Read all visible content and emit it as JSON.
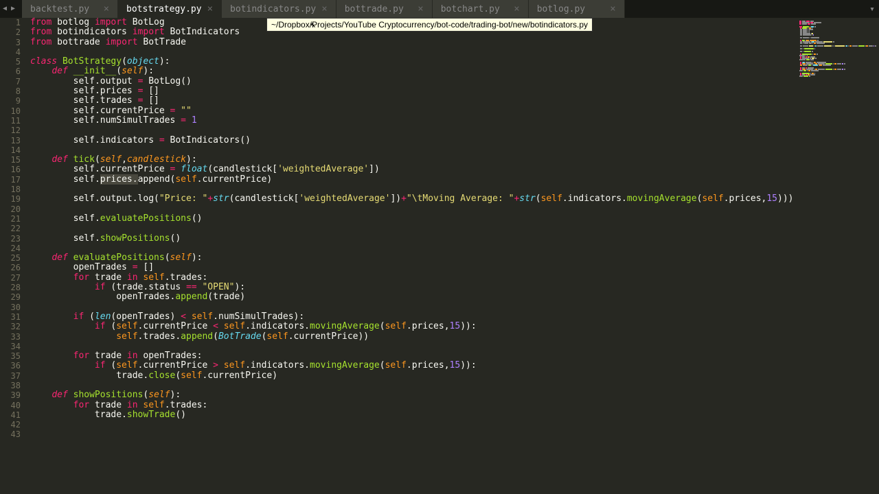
{
  "tabs": [
    {
      "label": "backtest.py",
      "active": false
    },
    {
      "label": "botstrategy.py",
      "active": true
    },
    {
      "label": "botindicators.py",
      "active": false
    },
    {
      "label": "bottrade.py",
      "active": false
    },
    {
      "label": "botchart.py",
      "active": false
    },
    {
      "label": "botlog.py",
      "active": false
    }
  ],
  "tooltip": "~/Dropbox/Projects/YouTube Cryptocurrency/bot-code/trading-bot/new/botindicators.py",
  "line_count": 43,
  "code_tokens": [
    [
      {
        "t": "from ",
        "c": "c-keyword"
      },
      {
        "t": "botlog ",
        "c": "c-default"
      },
      {
        "t": "import ",
        "c": "c-keyword"
      },
      {
        "t": "BotLog",
        "c": "c-default"
      }
    ],
    [
      {
        "t": "from ",
        "c": "c-keyword"
      },
      {
        "t": "botindicators ",
        "c": "c-default"
      },
      {
        "t": "import ",
        "c": "c-keyword"
      },
      {
        "t": "BotIndicators",
        "c": "c-default"
      }
    ],
    [
      {
        "t": "from ",
        "c": "c-keyword"
      },
      {
        "t": "bottrade ",
        "c": "c-default"
      },
      {
        "t": "import ",
        "c": "c-keyword"
      },
      {
        "t": "BotTrade",
        "c": "c-default"
      }
    ],
    [],
    [
      {
        "t": "class ",
        "c": "c-keyword2"
      },
      {
        "t": "BotStrategy",
        "c": "c-classname"
      },
      {
        "t": "(",
        "c": "c-default"
      },
      {
        "t": "object",
        "c": "c-builtin"
      },
      {
        "t": "):",
        "c": "c-default"
      }
    ],
    [
      {
        "t": "    ",
        "c": "c-default"
      },
      {
        "t": "def ",
        "c": "c-keyword2"
      },
      {
        "t": "__init__",
        "c": "c-func"
      },
      {
        "t": "(",
        "c": "c-default"
      },
      {
        "t": "self",
        "c": "c-param"
      },
      {
        "t": "):",
        "c": "c-default"
      }
    ],
    [
      {
        "t": "        ",
        "c": "c-default"
      },
      {
        "t": "self",
        "c": "c-default"
      },
      {
        "t": ".output ",
        "c": "c-default"
      },
      {
        "t": "= ",
        "c": "c-op"
      },
      {
        "t": "BotLog()",
        "c": "c-default"
      }
    ],
    [
      {
        "t": "        ",
        "c": "c-default"
      },
      {
        "t": "self",
        "c": "c-default"
      },
      {
        "t": ".prices ",
        "c": "c-default"
      },
      {
        "t": "= ",
        "c": "c-op"
      },
      {
        "t": "[]",
        "c": "c-default"
      }
    ],
    [
      {
        "t": "        ",
        "c": "c-default"
      },
      {
        "t": "self",
        "c": "c-default"
      },
      {
        "t": ".trades ",
        "c": "c-default"
      },
      {
        "t": "= ",
        "c": "c-op"
      },
      {
        "t": "[]",
        "c": "c-default"
      }
    ],
    [
      {
        "t": "        ",
        "c": "c-default"
      },
      {
        "t": "self",
        "c": "c-default"
      },
      {
        "t": ".currentPrice ",
        "c": "c-default"
      },
      {
        "t": "= ",
        "c": "c-op"
      },
      {
        "t": "\"\"",
        "c": "c-string"
      }
    ],
    [
      {
        "t": "        ",
        "c": "c-default"
      },
      {
        "t": "self",
        "c": "c-default"
      },
      {
        "t": ".numSimulTrades ",
        "c": "c-default"
      },
      {
        "t": "= ",
        "c": "c-op"
      },
      {
        "t": "1",
        "c": "c-number"
      }
    ],
    [],
    [
      {
        "t": "        ",
        "c": "c-default"
      },
      {
        "t": "self",
        "c": "c-default"
      },
      {
        "t": ".indicators ",
        "c": "c-default"
      },
      {
        "t": "= ",
        "c": "c-op"
      },
      {
        "t": "BotIndicators()",
        "c": "c-default"
      }
    ],
    [],
    [
      {
        "t": "    ",
        "c": "c-default"
      },
      {
        "t": "def ",
        "c": "c-keyword2"
      },
      {
        "t": "tick",
        "c": "c-func"
      },
      {
        "t": "(",
        "c": "c-default"
      },
      {
        "t": "self",
        "c": "c-param"
      },
      {
        "t": ",",
        "c": "c-default"
      },
      {
        "t": "candlestick",
        "c": "c-param"
      },
      {
        "t": "):",
        "c": "c-default"
      }
    ],
    [
      {
        "t": "        ",
        "c": "c-default"
      },
      {
        "t": "self",
        "c": "c-default"
      },
      {
        "t": ".currentPrice ",
        "c": "c-default"
      },
      {
        "t": "= ",
        "c": "c-op"
      },
      {
        "t": "float",
        "c": "c-builtin"
      },
      {
        "t": "(candlestick[",
        "c": "c-default"
      },
      {
        "t": "'weightedAverage'",
        "c": "c-string"
      },
      {
        "t": "])",
        "c": "c-default"
      }
    ],
    [
      {
        "t": "        ",
        "c": "c-default"
      },
      {
        "t": "self",
        "c": "c-default"
      },
      {
        "t": ".",
        "c": "c-default"
      },
      {
        "t": "prices.",
        "c": "c-default sel"
      },
      {
        "t": "append",
        "c": "c-default"
      },
      {
        "t": "(",
        "c": "c-default"
      },
      {
        "t": "self",
        "c": "c-paramself"
      },
      {
        "t": ".currentPrice)",
        "c": "c-default"
      }
    ],
    [],
    [
      {
        "t": "        ",
        "c": "c-default"
      },
      {
        "t": "self",
        "c": "c-default"
      },
      {
        "t": ".output.log(",
        "c": "c-default"
      },
      {
        "t": "\"Price: \"",
        "c": "c-string"
      },
      {
        "t": "+",
        "c": "c-op"
      },
      {
        "t": "str",
        "c": "c-builtin"
      },
      {
        "t": "(candlestick[",
        "c": "c-default"
      },
      {
        "t": "'weightedAverage'",
        "c": "c-string"
      },
      {
        "t": "])",
        "c": "c-default"
      },
      {
        "t": "+",
        "c": "c-op"
      },
      {
        "t": "\"\\tMoving Average: \"",
        "c": "c-string"
      },
      {
        "t": "+",
        "c": "c-op"
      },
      {
        "t": "str",
        "c": "c-builtin"
      },
      {
        "t": "(",
        "c": "c-default"
      },
      {
        "t": "self",
        "c": "c-paramself"
      },
      {
        "t": ".indicators.",
        "c": "c-default"
      },
      {
        "t": "movingAverage",
        "c": "c-func"
      },
      {
        "t": "(",
        "c": "c-default"
      },
      {
        "t": "self",
        "c": "c-paramself"
      },
      {
        "t": ".prices,",
        "c": "c-default"
      },
      {
        "t": "15",
        "c": "c-number"
      },
      {
        "t": ")))",
        "c": "c-default"
      }
    ],
    [],
    [
      {
        "t": "        ",
        "c": "c-default"
      },
      {
        "t": "self",
        "c": "c-default"
      },
      {
        "t": ".",
        "c": "c-default"
      },
      {
        "t": "evaluatePositions",
        "c": "c-func"
      },
      {
        "t": "()",
        "c": "c-default"
      }
    ],
    [],
    [
      {
        "t": "        ",
        "c": "c-default"
      },
      {
        "t": "self",
        "c": "c-default"
      },
      {
        "t": ".",
        "c": "c-default"
      },
      {
        "t": "showPositions",
        "c": "c-func"
      },
      {
        "t": "()",
        "c": "c-default"
      }
    ],
    [],
    [
      {
        "t": "    ",
        "c": "c-default"
      },
      {
        "t": "def ",
        "c": "c-keyword2"
      },
      {
        "t": "evaluatePositions",
        "c": "c-func"
      },
      {
        "t": "(",
        "c": "c-default"
      },
      {
        "t": "self",
        "c": "c-param"
      },
      {
        "t": "):",
        "c": "c-default"
      }
    ],
    [
      {
        "t": "        openTrades ",
        "c": "c-default"
      },
      {
        "t": "= ",
        "c": "c-op"
      },
      {
        "t": "[]",
        "c": "c-default"
      }
    ],
    [
      {
        "t": "        ",
        "c": "c-default"
      },
      {
        "t": "for ",
        "c": "c-keyword"
      },
      {
        "t": "trade ",
        "c": "c-default"
      },
      {
        "t": "in ",
        "c": "c-keyword"
      },
      {
        "t": "self",
        "c": "c-paramself"
      },
      {
        "t": ".trades:",
        "c": "c-default"
      }
    ],
    [
      {
        "t": "            ",
        "c": "c-default"
      },
      {
        "t": "if ",
        "c": "c-keyword"
      },
      {
        "t": "(trade.status ",
        "c": "c-default"
      },
      {
        "t": "== ",
        "c": "c-op"
      },
      {
        "t": "\"OPEN\"",
        "c": "c-string"
      },
      {
        "t": "):",
        "c": "c-default"
      }
    ],
    [
      {
        "t": "                openTrades.",
        "c": "c-default"
      },
      {
        "t": "append",
        "c": "c-func"
      },
      {
        "t": "(trade)",
        "c": "c-default"
      }
    ],
    [],
    [
      {
        "t": "        ",
        "c": "c-default"
      },
      {
        "t": "if ",
        "c": "c-keyword"
      },
      {
        "t": "(",
        "c": "c-default"
      },
      {
        "t": "len",
        "c": "c-builtin"
      },
      {
        "t": "(openTrades) ",
        "c": "c-default"
      },
      {
        "t": "< ",
        "c": "c-op"
      },
      {
        "t": "self",
        "c": "c-paramself"
      },
      {
        "t": ".numSimulTrades):",
        "c": "c-default"
      }
    ],
    [
      {
        "t": "            ",
        "c": "c-default"
      },
      {
        "t": "if ",
        "c": "c-keyword"
      },
      {
        "t": "(",
        "c": "c-default"
      },
      {
        "t": "self",
        "c": "c-paramself"
      },
      {
        "t": ".currentPrice ",
        "c": "c-default"
      },
      {
        "t": "< ",
        "c": "c-op"
      },
      {
        "t": "self",
        "c": "c-paramself"
      },
      {
        "t": ".indicators.",
        "c": "c-default"
      },
      {
        "t": "movingAverage",
        "c": "c-func"
      },
      {
        "t": "(",
        "c": "c-default"
      },
      {
        "t": "self",
        "c": "c-paramself"
      },
      {
        "t": ".prices,",
        "c": "c-default"
      },
      {
        "t": "15",
        "c": "c-number"
      },
      {
        "t": ")):",
        "c": "c-default"
      }
    ],
    [
      {
        "t": "                ",
        "c": "c-default"
      },
      {
        "t": "self",
        "c": "c-paramself"
      },
      {
        "t": ".trades.",
        "c": "c-default"
      },
      {
        "t": "append",
        "c": "c-func"
      },
      {
        "t": "(",
        "c": "c-default"
      },
      {
        "t": "BotTrade",
        "c": "c-type"
      },
      {
        "t": "(",
        "c": "c-default"
      },
      {
        "t": "self",
        "c": "c-paramself"
      },
      {
        "t": ".currentPrice))",
        "c": "c-default"
      }
    ],
    [],
    [
      {
        "t": "        ",
        "c": "c-default"
      },
      {
        "t": "for ",
        "c": "c-keyword"
      },
      {
        "t": "trade ",
        "c": "c-default"
      },
      {
        "t": "in ",
        "c": "c-keyword"
      },
      {
        "t": "openTrades:",
        "c": "c-default"
      }
    ],
    [
      {
        "t": "            ",
        "c": "c-default"
      },
      {
        "t": "if ",
        "c": "c-keyword"
      },
      {
        "t": "(",
        "c": "c-default"
      },
      {
        "t": "self",
        "c": "c-paramself"
      },
      {
        "t": ".currentPrice ",
        "c": "c-default"
      },
      {
        "t": "> ",
        "c": "c-op"
      },
      {
        "t": "self",
        "c": "c-paramself"
      },
      {
        "t": ".indicators.",
        "c": "c-default"
      },
      {
        "t": "movingAverage",
        "c": "c-func"
      },
      {
        "t": "(",
        "c": "c-default"
      },
      {
        "t": "self",
        "c": "c-paramself"
      },
      {
        "t": ".prices,",
        "c": "c-default"
      },
      {
        "t": "15",
        "c": "c-number"
      },
      {
        "t": ")):",
        "c": "c-default"
      }
    ],
    [
      {
        "t": "                trade.",
        "c": "c-default"
      },
      {
        "t": "close",
        "c": "c-func"
      },
      {
        "t": "(",
        "c": "c-default"
      },
      {
        "t": "self",
        "c": "c-paramself"
      },
      {
        "t": ".currentPrice)",
        "c": "c-default"
      }
    ],
    [],
    [
      {
        "t": "    ",
        "c": "c-default"
      },
      {
        "t": "def ",
        "c": "c-keyword2"
      },
      {
        "t": "showPositions",
        "c": "c-func"
      },
      {
        "t": "(",
        "c": "c-default"
      },
      {
        "t": "self",
        "c": "c-param"
      },
      {
        "t": "):",
        "c": "c-default"
      }
    ],
    [
      {
        "t": "        ",
        "c": "c-default"
      },
      {
        "t": "for ",
        "c": "c-keyword"
      },
      {
        "t": "trade ",
        "c": "c-default"
      },
      {
        "t": "in ",
        "c": "c-keyword"
      },
      {
        "t": "self",
        "c": "c-paramself"
      },
      {
        "t": ".trades:",
        "c": "c-default"
      }
    ],
    [
      {
        "t": "            trade.",
        "c": "c-default"
      },
      {
        "t": "showTrade",
        "c": "c-func"
      },
      {
        "t": "()",
        "c": "c-default"
      }
    ],
    [],
    []
  ],
  "minimap_colors": [
    "#f92672",
    "#a6e22e",
    "#66d9ef",
    "#e6db74",
    "#f8f8f2",
    "#ae81ff",
    "#fd971f"
  ]
}
